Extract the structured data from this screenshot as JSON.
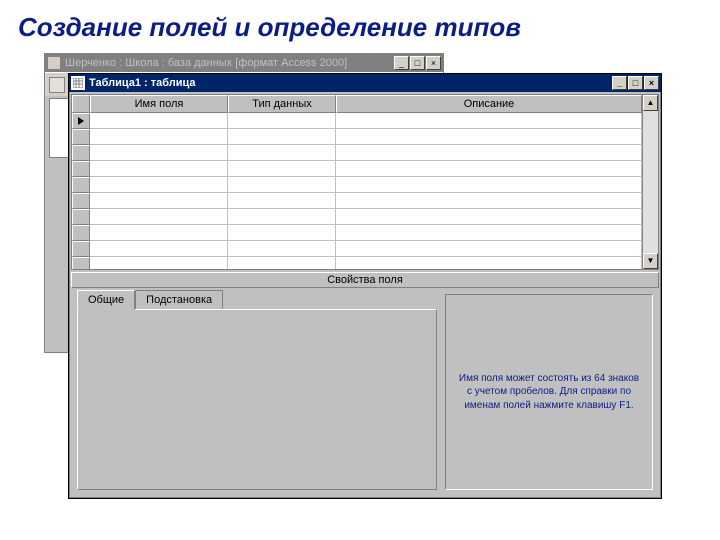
{
  "page": {
    "title": "Создание полей и определение типов"
  },
  "db_window": {
    "title": "Шерченко : Школа : база данных [формат Access 2000]",
    "controls": {
      "min": "_",
      "max": "□",
      "close": "×"
    }
  },
  "main_window": {
    "title": "Таблица1 : таблица",
    "controls": {
      "min": "_",
      "max": "□",
      "close": "×"
    }
  },
  "grid": {
    "headers": {
      "name": "Имя поля",
      "type": "Тип данных",
      "desc": "Описание"
    }
  },
  "props": {
    "header": "Свойства поля",
    "tabs": {
      "general": "Общие",
      "lookup": "Подстановка"
    }
  },
  "help": {
    "text": "Имя поля может состоять из 64 знаков с учетом пробелов.  Для справки по именам полей нажмите клавишу F1."
  },
  "scroll": {
    "up": "▲",
    "down": "▼"
  }
}
